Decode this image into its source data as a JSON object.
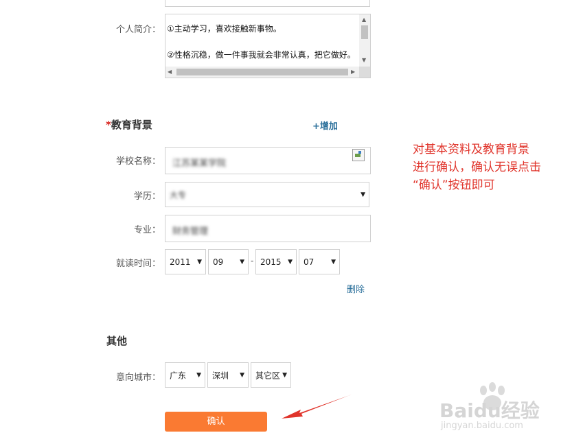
{
  "intro": {
    "label": "个人简介：",
    "line1": "①主动学习，喜欢接触新事物。",
    "line2": "②性格沉稳，做一件事我就会非常认真，把它做好。"
  },
  "education": {
    "required_mark": "*",
    "title": "教育背景",
    "add_link": "+增加",
    "school_label": "学校名称：",
    "school_value": "江苏某某学院",
    "degree_label": "学历：",
    "degree_value": "大专",
    "major_label": "专业：",
    "major_value": "财务管理",
    "period_label": "就读时间：",
    "start_year": "2011",
    "start_month": "09",
    "separator": "-",
    "end_year": "2015",
    "end_month": "07",
    "delete_link": "删除"
  },
  "other": {
    "title": "其他",
    "city_label": "意向城市：",
    "province": "广东",
    "city": "深圳",
    "district": "其它区"
  },
  "confirm_button": "确认",
  "annotation": {
    "line1": "对基本资料及教育背景",
    "line2": "进行确认，确认无误点击",
    "line3": "“确认”按钮即可"
  },
  "watermark": {
    "brand": "Baidu经验",
    "url": "jingyan.baidu.com"
  },
  "colors": {
    "button": "#fa7a32",
    "link": "#2a6f9a",
    "annotation": "#e0342b",
    "required": "#d9221c"
  }
}
